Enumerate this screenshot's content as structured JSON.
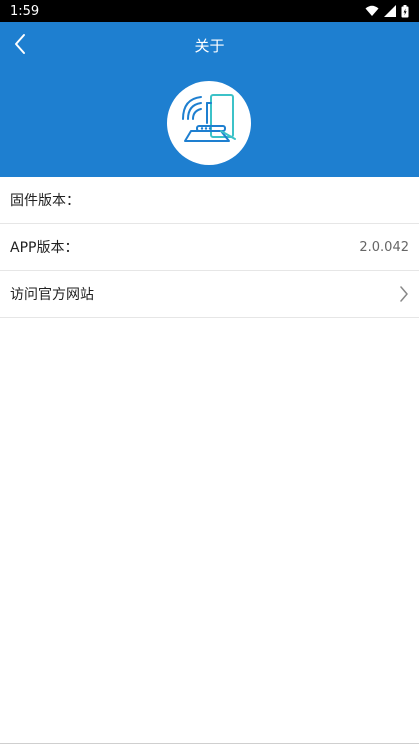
{
  "status_bar": {
    "time": "1:59",
    "icons": [
      "wifi-icon",
      "signal-icon",
      "battery-icon"
    ]
  },
  "header": {
    "title": "关于",
    "background_color": "#1e7fd0",
    "back_icon": "chevron-left-icon",
    "logo_icon": "router-wifi-device-icon"
  },
  "rows": [
    {
      "label": "固件版本：",
      "value": ""
    },
    {
      "label": "APP版本：",
      "value": "2.0.042"
    },
    {
      "label": "访问官方网站",
      "chevron_icon": "chevron-right-icon"
    }
  ]
}
